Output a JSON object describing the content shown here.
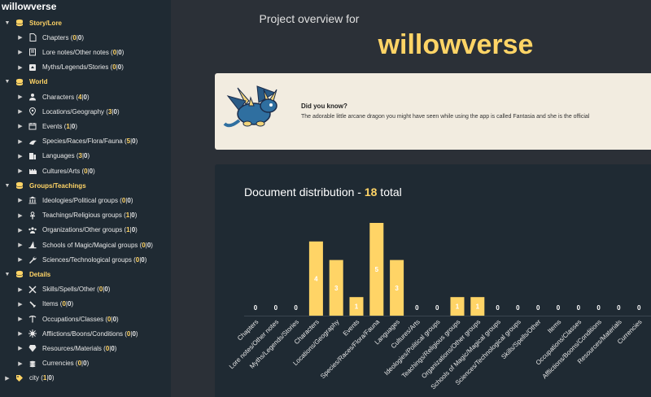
{
  "sidebar": {
    "title": "willowverse",
    "rows": [
      {
        "kind": "cat",
        "label": "Story/Lore",
        "icon": "stack-icon"
      },
      {
        "kind": "doc",
        "label": "Chapters",
        "a": "0",
        "b": "0",
        "icon": "document-icon"
      },
      {
        "kind": "doc",
        "label": "Lore notes/Other notes",
        "a": "0",
        "b": "0",
        "icon": "book-icon"
      },
      {
        "kind": "doc",
        "label": "Myths/Legends/Stories",
        "a": "0",
        "b": "0",
        "icon": "dragon-book-icon"
      },
      {
        "kind": "cat",
        "label": "World",
        "icon": "stack-icon"
      },
      {
        "kind": "doc",
        "label": "Characters",
        "a": "4",
        "b": "0",
        "icon": "person-icon"
      },
      {
        "kind": "doc",
        "label": "Locations/Geography",
        "a": "3",
        "b": "0",
        "icon": "map-pin-icon"
      },
      {
        "kind": "doc",
        "label": "Events",
        "a": "1",
        "b": "0",
        "icon": "calendar-icon"
      },
      {
        "kind": "doc",
        "label": "Species/Races/Flora/Fauna",
        "a": "5",
        "b": "0",
        "icon": "paw-icon"
      },
      {
        "kind": "doc",
        "label": "Languages",
        "a": "3",
        "b": "0",
        "icon": "language-icon"
      },
      {
        "kind": "doc",
        "label": "Cultures/Arts",
        "a": "0",
        "b": "0",
        "icon": "castle-icon"
      },
      {
        "kind": "cat",
        "label": "Groups/Teachings",
        "icon": "stack-icon"
      },
      {
        "kind": "doc",
        "label": "Ideologies/Political groups",
        "a": "0",
        "b": "0",
        "icon": "bank-icon"
      },
      {
        "kind": "doc",
        "label": "Teachings/Religious groups",
        "a": "1",
        "b": "0",
        "icon": "ankh-icon"
      },
      {
        "kind": "doc",
        "label": "Organizations/Other groups",
        "a": "1",
        "b": "0",
        "icon": "group-icon"
      },
      {
        "kind": "doc",
        "label": "Schools of Magic/Magical groups",
        "a": "0",
        "b": "0",
        "icon": "wizard-hat-icon"
      },
      {
        "kind": "doc",
        "label": "Sciences/Technological groups",
        "a": "0",
        "b": "0",
        "icon": "wrench-icon"
      },
      {
        "kind": "cat",
        "label": "Details",
        "icon": "stack-icon"
      },
      {
        "kind": "doc",
        "label": "Skills/Spells/Other",
        "a": "0",
        "b": "0",
        "icon": "crossed-swords-icon"
      },
      {
        "kind": "doc",
        "label": "Items",
        "a": "0",
        "b": "0",
        "icon": "sword-icon"
      },
      {
        "kind": "doc",
        "label": "Occupations/Classes",
        "a": "0",
        "b": "0",
        "icon": "pickaxe-icon"
      },
      {
        "kind": "doc",
        "label": "Afflictions/Boons/Conditions",
        "a": "0",
        "b": "0",
        "icon": "burst-icon"
      },
      {
        "kind": "doc",
        "label": "Resources/Materials",
        "a": "0",
        "b": "0",
        "icon": "gem-icon"
      },
      {
        "kind": "doc",
        "label": "Currencies",
        "a": "0",
        "b": "0",
        "icon": "coins-icon"
      },
      {
        "kind": "top",
        "label": "city",
        "a": "1",
        "b": "0",
        "icon": "tag-icon"
      }
    ]
  },
  "header": {
    "overview_label": "Project overview for",
    "project_name": "willowverse"
  },
  "tip": {
    "title": "Did you know?",
    "text": "The adorable little arcane dragon you might have seen while using the app is called Fantasia and she is the official"
  },
  "chart_header": {
    "label": "Document distribution - ",
    "total": "18",
    "suffix": " total"
  },
  "colors": {
    "accent": "#ffd466",
    "sidebar_bg": "#1f2a33",
    "main_bg": "#2b3037",
    "bar": "#ffd466"
  },
  "chart_data": {
    "type": "bar",
    "categories": [
      "Chapters",
      "Lore notes/Other notes",
      "Myths/Legends/Stories",
      "Characters",
      "Locations/Geography",
      "Events",
      "Species/Races/Flora/Fauna",
      "Languages",
      "Cultures/Arts",
      "Ideologies/Political groups",
      "Teachings/Religious groups",
      "Organizations/Other groups",
      "Schools of Magic/Magical groups",
      "Sciences/Technological groups",
      "Skills/Spells/Other",
      "Items",
      "Occupations/Classes",
      "Afflictions/Boons/Conditions",
      "Resources/Materials",
      "Currencies"
    ],
    "values": [
      0,
      0,
      0,
      4,
      3,
      1,
      5,
      3,
      0,
      0,
      1,
      1,
      0,
      0,
      0,
      0,
      0,
      0,
      0,
      0
    ],
    "data_labels": true,
    "grid": false,
    "ylim": [
      0,
      5
    ]
  }
}
